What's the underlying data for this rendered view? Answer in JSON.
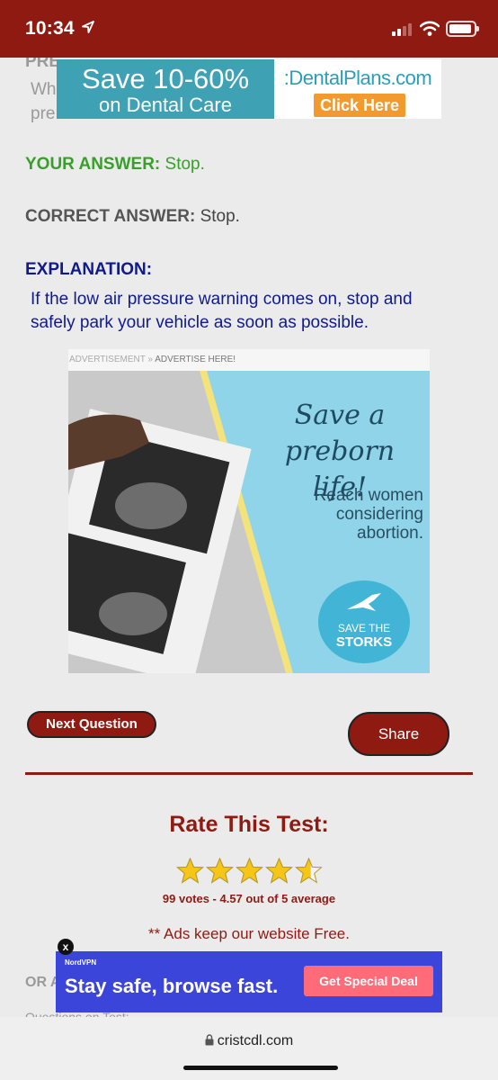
{
  "status": {
    "time": "10:34"
  },
  "behind": {
    "line1": "PRE",
    "line2": "Wh",
    "line3": "pre",
    "bottom1": "OR A",
    "bottom2": "Questions on Test:"
  },
  "top_ad": {
    "headline": "Save 10-60%",
    "subline": "on Dental Care",
    "brand": ":DentalPlans.com",
    "cta": "Click Here"
  },
  "answers": {
    "your_label": "YOUR ANSWER:",
    "your_value": "Stop.",
    "correct_label": "CORRECT ANSWER:",
    "correct_value": "Stop.",
    "explanation_label": "EXPLANATION:",
    "explanation_text": "If the low air pressure warning comes on, stop and safely park your vehicle as soon as possible."
  },
  "middle_ad": {
    "label": "ADVERTISEMENT »",
    "link": "ADVERTISE HERE!",
    "script": "Save a preborn life!",
    "copy": "Reach women considering abortion.",
    "logo_line1": "SAVE THE",
    "logo_line2": "STORKS"
  },
  "buttons": {
    "next": "Next Question",
    "share": "Share"
  },
  "rating": {
    "title": "Rate This Test:",
    "votes_text": "99 votes - 4.57 out of 5 average",
    "average": 4.57,
    "max": 5
  },
  "ads_note": "** Ads keep our website Free.",
  "bottom_ad": {
    "brand": "NordVPN",
    "headline": "Stay safe, browse fast.",
    "cta": "Get Special Deal",
    "close": "x"
  },
  "url": "cristcdl.com",
  "colors": {
    "brand_red": "#8f1a12",
    "green": "#38a02a",
    "navy": "#0f1a8c"
  }
}
